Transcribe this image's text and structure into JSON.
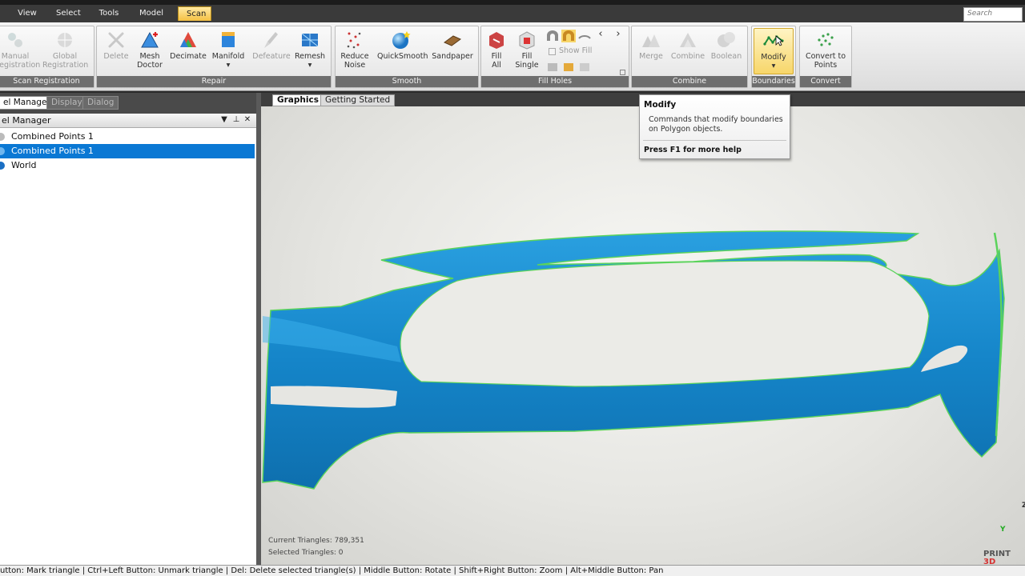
{
  "menu": {
    "tabs": [
      {
        "label": "View"
      },
      {
        "label": "Select"
      },
      {
        "label": "Tools"
      },
      {
        "label": "Model"
      },
      {
        "label": "Scan",
        "active": true
      }
    ],
    "search_placeholder": "Search"
  },
  "ribbon": {
    "groups": {
      "scan_registration": "Scan Registration",
      "repair": "Repair",
      "smooth": "Smooth",
      "fill_holes": "Fill Holes",
      "combine": "Combine",
      "boundaries": "Boundaries",
      "convert": "Convert"
    },
    "tools": {
      "manual_registration": [
        "Manual",
        "Registration"
      ],
      "global_registration": [
        "Global",
        "Registration"
      ],
      "delete": "Delete",
      "mesh_doctor": [
        "Mesh",
        "Doctor"
      ],
      "decimate": "Decimate",
      "manifold": "Manifold",
      "defeature": "Defeature",
      "remesh": "Remesh",
      "reduce_noise": [
        "Reduce",
        "Noise"
      ],
      "quicksmooth": "QuickSmooth",
      "sandpaper": "Sandpaper",
      "fill_all": [
        "Fill",
        "All"
      ],
      "fill_single": [
        "Fill",
        "Single"
      ],
      "show_fill": "Show Fill",
      "merge": "Merge",
      "combine": "Combine",
      "boolean": "Boolean",
      "modify": "Modify",
      "convert_to_points": [
        "Convert to",
        "Points"
      ]
    }
  },
  "left_panel": {
    "tabs": [
      {
        "label": "el Manager",
        "active": true
      },
      {
        "label": "Display"
      },
      {
        "label": "Dialog"
      }
    ],
    "title": "el Manager",
    "controls": {
      "dropdown": "▼",
      "pin": "⊥",
      "close": "✕"
    },
    "tree": [
      {
        "label": "Combined Points 1",
        "selected": false
      },
      {
        "label": "Combined Points 1",
        "selected": true
      },
      {
        "label": "World",
        "selected": false
      }
    ]
  },
  "viewport": {
    "tabs": [
      {
        "label": "Graphics",
        "active": true
      },
      {
        "label": "Getting Started"
      }
    ],
    "current_triangles": "Current Triangles: 789,351",
    "selected_triangles": "Selected Triangles: 0",
    "axis_y": "Y",
    "axis_z": "Z"
  },
  "tooltip": {
    "title": "Modify",
    "description": "Commands that modify boundaries on Polygon objects.",
    "help": "Press F1 for more help"
  },
  "status_bar": {
    "text": "utton: Mark triangle | Ctrl+Left Button: Unmark triangle | Del: Delete selected triangle(s) | Middle Button: Rotate | Shift+Right Button: Zoom | Alt+Middle Button: Pan"
  },
  "watermark": {
    "line1": "PRINT",
    "line2": "3D"
  },
  "colors": {
    "accent_active_tab": "#f4c042",
    "selection_blue": "#0a78d4",
    "mesh_blue": "#1b8fd2",
    "boundary_green": "#5bd35b"
  }
}
